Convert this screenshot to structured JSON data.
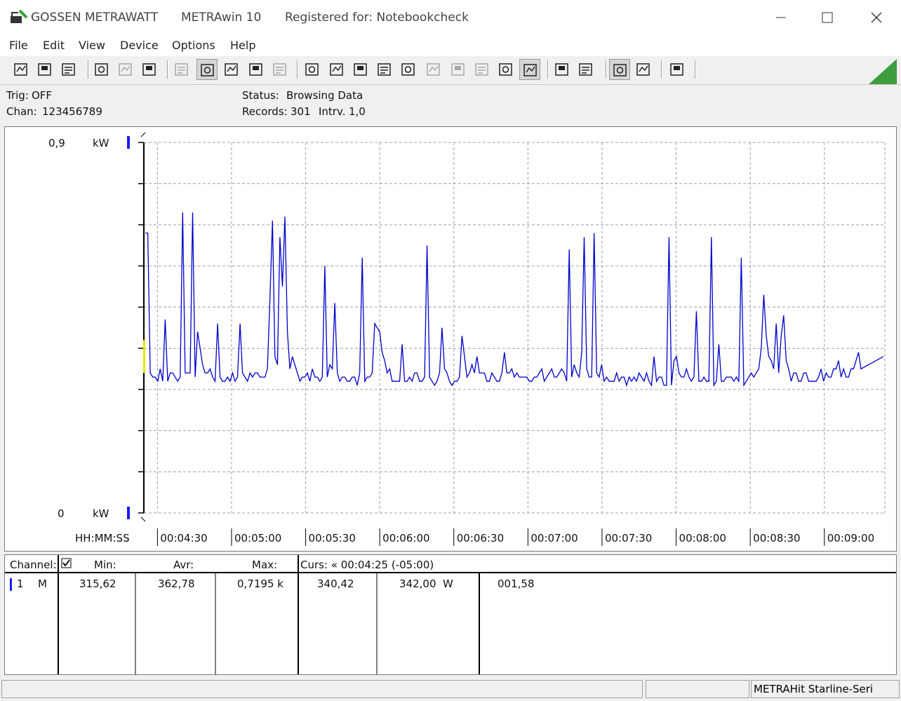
{
  "titlebar": {
    "brand": "GOSSEN METRAWATT",
    "app_name": "METRAwin 10",
    "registration": "Registered for: Notebookcheck"
  },
  "menu": [
    "File",
    "Edit",
    "View",
    "Device",
    "Options",
    "Help"
  ],
  "toolbar_icons": [
    "save-icon",
    "save-as-icon",
    "open-folder-icon",
    "device-read-icon",
    "device-disabled-icon",
    "device-send-icon",
    "keyboard-icon",
    "waveform-view-icon",
    "crosshair-icon",
    "table-view-icon",
    "grid-disabled-icon",
    "transfer-icon",
    "capture-icon",
    "graph-settings-icon",
    "monitor-icon",
    "function-icon",
    "measure-disabled-icon",
    "signal-disabled-icon",
    "noise-disabled-icon",
    "settings-icon",
    "trigger-icon",
    "print-preview-icon",
    "print-icon",
    "zoom-waveform-icon",
    "zoom-detail-icon",
    "comment-icon"
  ],
  "info": {
    "trig_label": "Trig:",
    "trig_value": "OFF",
    "chan_label": "Chan:",
    "chan_value": "123456789",
    "status_label": "Status:",
    "status_value": "Browsing Data",
    "records_label": "Records:",
    "records_value": "301",
    "interval_label": "Intrv.",
    "interval_value": "1,0"
  },
  "chart_data": {
    "type": "line",
    "x_axis_label": "HH:MM:SS",
    "x_tick_labels": [
      "00:04:30",
      "00:05:00",
      "00:05:30",
      "00:06:00",
      "00:06:30",
      "00:07:00",
      "00:07:30",
      "00:08:00",
      "00:08:30",
      "00:09:00"
    ],
    "x_start_seconds": 265,
    "x_interval_seconds": 1,
    "y_max_label": "0,9",
    "y_min_label": "0",
    "y_unit": "kW",
    "ylim": [
      0,
      0.9
    ],
    "grid": true,
    "series": [
      {
        "color": "#0000cc",
        "values": [
          0.68,
          0.51,
          0.34,
          0.33,
          0.33,
          0.32,
          0.35,
          0.32,
          0.35,
          0.32,
          0.34,
          0.34,
          0.33,
          0.32,
          0.33,
          0.35,
          0.34,
          0.34,
          0.34,
          0.33,
          0.33,
          0.47,
          0.4,
          0.36,
          0.34,
          0.34,
          0.35,
          0.33,
          0.32,
          0.34,
          0.33,
          0.32,
          0.32,
          0.33,
          0.32,
          0.34,
          0.32,
          0.33,
          0.33,
          0.34,
          0.33,
          0.32,
          0.34,
          0.33,
          0.34,
          0.34,
          0.33,
          0.33,
          0.33,
          0.35,
          0.52,
          0.71,
          0.38,
          0.36,
          0.34,
          0.55,
          0.72,
          0.44,
          0.35,
          0.38,
          0.36,
          0.34,
          0.32,
          0.33,
          0.33,
          0.34,
          0.32,
          0.35,
          0.33,
          0.33,
          0.32,
          0.33,
          0.32,
          0.33,
          0.36,
          0.35,
          0.31,
          0.34,
          0.32,
          0.33,
          0.33,
          0.32,
          0.32,
          0.33,
          0.33,
          0.31,
          0.34,
          0.32,
          0.32,
          0.33,
          0.33,
          0.34,
          0.33,
          0.45,
          0.44,
          0.39,
          0.37,
          0.34,
          0.35,
          0.32,
          0.32,
          0.32,
          0.32,
          0.33,
          0.32,
          0.32,
          0.33,
          0.32,
          0.34,
          0.34,
          0.32,
          0.32,
          0.33,
          0.33,
          0.33,
          0.32,
          0.31,
          0.32,
          0.34,
          0.45,
          0.35,
          0.34,
          0.32,
          0.31,
          0.32,
          0.32,
          0.33,
          0.36,
          0.38,
          0.33,
          0.34,
          0.36,
          0.34,
          0.35,
          0.34,
          0.34,
          0.34,
          0.32,
          0.32,
          0.34,
          0.33,
          0.32,
          0.32,
          0.34,
          0.35,
          0.34,
          0.34,
          0.35,
          0.33,
          0.34,
          0.33,
          0.33,
          0.33,
          0.33,
          0.32,
          0.32,
          0.33,
          0.33,
          0.34,
          0.35,
          0.32,
          0.33,
          0.34,
          0.35,
          0.33,
          0.33,
          0.34,
          0.35,
          0.34,
          0.32,
          0.33,
          0.33,
          0.36,
          0.34,
          0.33,
          0.39,
          0.67,
          0.35,
          0.33,
          0.33,
          0.32,
          0.34,
          0.33,
          0.34,
          0.32,
          0.33,
          0.32,
          0.32,
          0.32,
          0.34,
          0.32,
          0.33,
          0.33,
          0.31,
          0.33,
          0.32,
          0.33,
          0.32,
          0.34,
          0.33,
          0.32,
          0.34,
          0.32,
          0.31,
          0.33,
          0.32,
          0.33,
          0.33,
          0.31,
          0.31,
          0.32,
          0.31,
          0.37,
          0.38,
          0.34,
          0.33,
          0.33,
          0.35,
          0.33,
          0.32,
          0.33,
          0.34,
          0.32,
          0.32,
          0.33,
          0.32,
          0.32,
          0.33,
          0.31,
          0.32,
          0.32,
          0.32,
          0.32,
          0.33,
          0.33,
          0.33,
          0.32,
          0.33,
          0.32,
          0.32,
          0.31,
          0.32,
          0.33,
          0.34,
          0.33,
          0.34,
          0.35,
          0.4,
          0.53,
          0.43,
          0.38,
          0.37,
          0.35,
          0.37,
          0.34,
          0.43,
          0.48,
          0.37,
          0.35,
          0.32,
          0.34,
          0.34,
          0.32,
          0.32,
          0.34,
          0.34,
          0.32,
          0.32,
          0.32,
          0.32,
          0.33,
          0.35,
          0.32,
          0.34,
          0.33,
          0.33,
          0.35,
          0.35,
          0.37,
          0.33,
          0.35,
          0.33,
          0.33,
          0.35,
          0.35,
          0.37,
          0.39,
          0.35
        ],
        "spikes": [
          {
            "i": 1,
            "v": 0.68
          },
          {
            "i": 8,
            "v": 0.47
          },
          {
            "i": 15,
            "v": 0.73
          },
          {
            "i": 19,
            "v": 0.73
          },
          {
            "i": 21,
            "v": 0.44
          },
          {
            "i": 29,
            "v": 0.46
          },
          {
            "i": 38,
            "v": 0.46
          },
          {
            "i": 54,
            "v": 0.67
          },
          {
            "i": 72,
            "v": 0.6
          },
          {
            "i": 76,
            "v": 0.51
          },
          {
            "i": 87,
            "v": 0.62
          },
          {
            "i": 92,
            "v": 0.46
          },
          {
            "i": 103,
            "v": 0.41
          },
          {
            "i": 113,
            "v": 0.65
          },
          {
            "i": 127,
            "v": 0.43
          },
          {
            "i": 133,
            "v": 0.38
          },
          {
            "i": 144,
            "v": 0.39
          },
          {
            "i": 170,
            "v": 0.64
          },
          {
            "i": 180,
            "v": 0.68
          },
          {
            "i": 183,
            "v": 0.36
          },
          {
            "i": 204,
            "v": 0.38
          },
          {
            "i": 210,
            "v": 0.67
          },
          {
            "i": 221,
            "v": 0.49
          },
          {
            "i": 227,
            "v": 0.67
          },
          {
            "i": 230,
            "v": 0.41
          },
          {
            "i": 239,
            "v": 0.62
          },
          {
            "i": 253,
            "v": 0.46
          },
          {
            "i": 296,
            "v": 0.38
          }
        ]
      }
    ]
  },
  "table": {
    "channel_label": "Channel:",
    "min_label": "Min:",
    "avr_label": "Avr:",
    "max_label": "Max:",
    "cursor_label": "Curs: « 00:04:25 (-05:00)",
    "row": {
      "channel": "1",
      "mode": "M",
      "min": "315,62",
      "avr": "362,78",
      "max": "0,7195 k",
      "curs_a": "340,42",
      "curs_b": "342,00",
      "unit": "W",
      "diff": "001,58"
    }
  },
  "statusbar": {
    "device": "METRAHit Starline-Seri"
  },
  "colors": {
    "trace": "#0000cc",
    "grid": "#a0a0a0",
    "marker": "#1a1aff",
    "highlight": "#e6e600"
  }
}
